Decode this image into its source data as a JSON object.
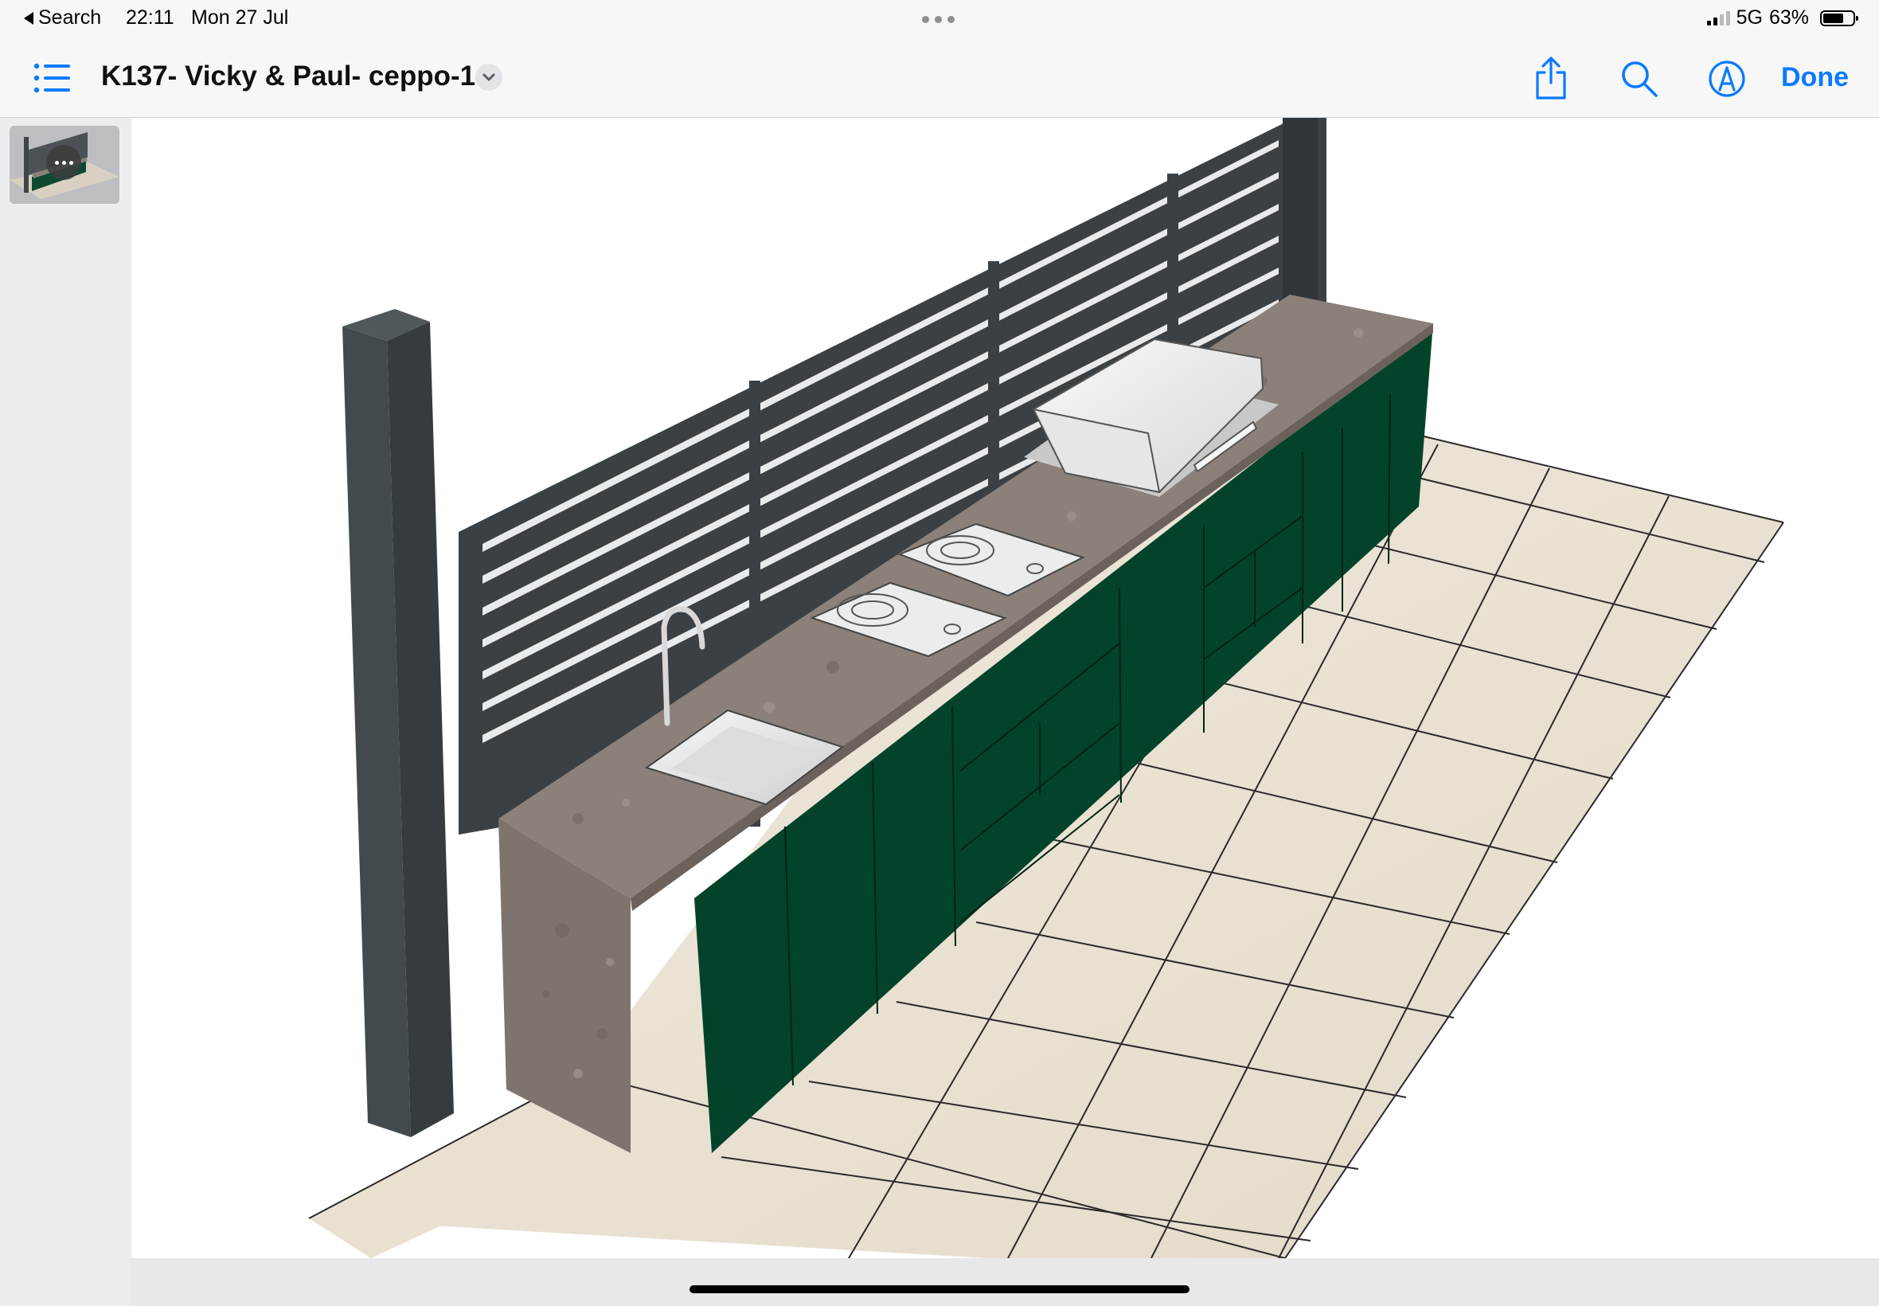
{
  "status_bar": {
    "back_label": "Search",
    "time": "22:11",
    "date": "Mon 27 Jul",
    "network": "5G",
    "battery_percent": "63%",
    "battery_level": 0.63
  },
  "nav": {
    "title": "K137- Vicky & Paul- ceppo-1",
    "done_label": "Done",
    "icons": [
      "list-icon",
      "chevron-down-icon",
      "share-icon",
      "search-icon",
      "markup-icon"
    ],
    "accent_color": "#0a7aff"
  },
  "sidebar": {
    "pages": [
      {
        "thumbnail": "kitchen-render-thumbnail",
        "more_icon": "ellipsis-icon"
      }
    ]
  },
  "document": {
    "content": "3d-render",
    "colors": {
      "cabinet": "#03432a",
      "worktop": "#8b817a",
      "screen": "#3f4548",
      "floor_tile": "#ebe4d6",
      "appliance": "#f0f0f0"
    }
  }
}
